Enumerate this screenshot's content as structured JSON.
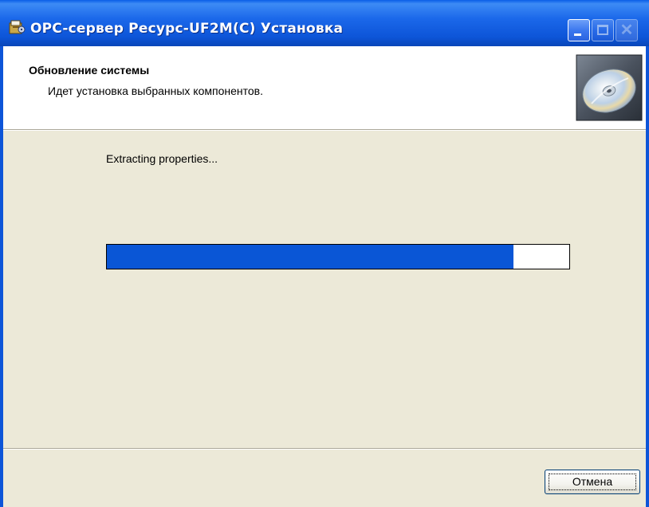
{
  "window": {
    "title": "OPC-сервер Ресурс-UF2M(C) Установка",
    "icon": "installer-icon",
    "controls": {
      "minimize_icon": "minimize-icon",
      "maximize_icon": "maximize-icon",
      "close_icon": "close-icon",
      "close_glyph": "✕"
    }
  },
  "header": {
    "title": "Обновление системы",
    "subtitle": "Идет установка выбранных компонентов.",
    "image_icon": "cd-disc-icon"
  },
  "body": {
    "status_text": "Extracting properties...",
    "progress_fraction": 0.88
  },
  "footer": {
    "cancel_label": "Отмена"
  },
  "colors": {
    "titlebar": "#0d55d8",
    "progress_fill": "#0a56d6",
    "face": "#ece9d8"
  }
}
